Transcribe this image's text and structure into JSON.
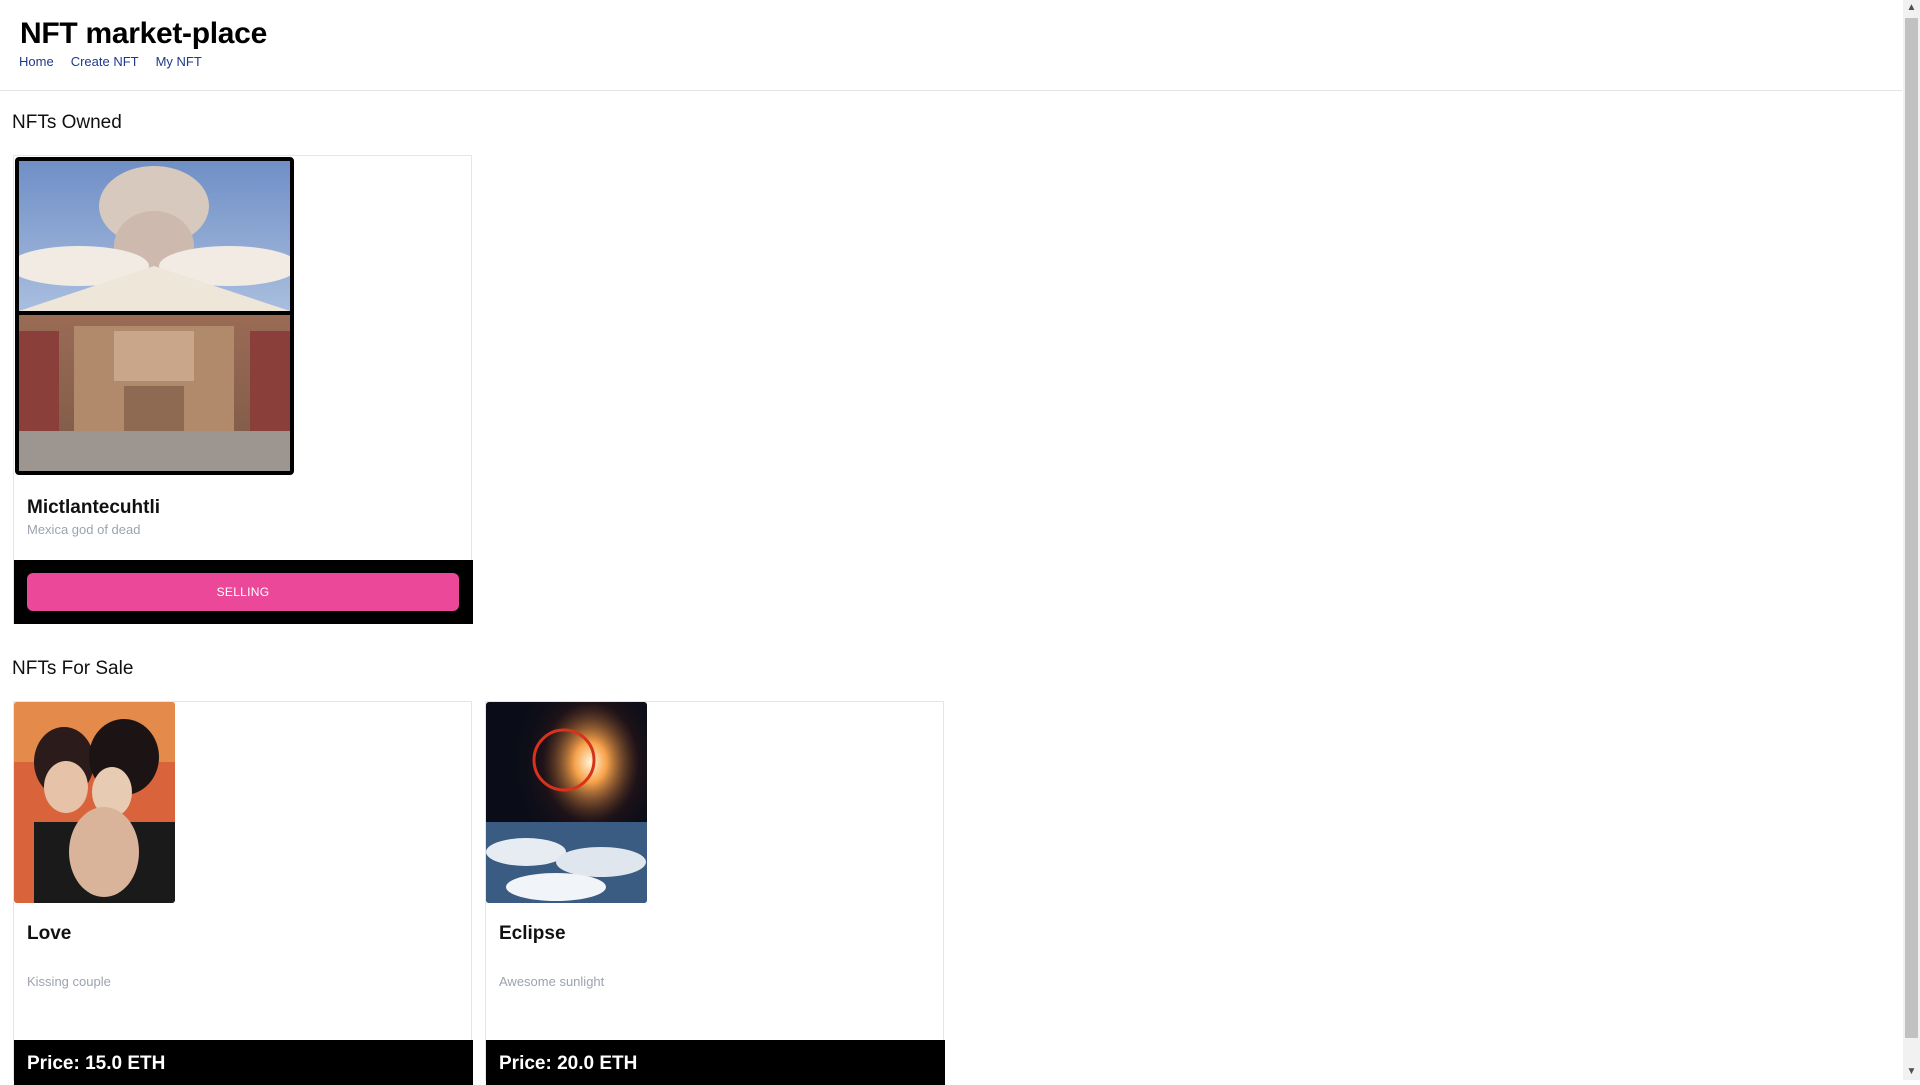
{
  "header": {
    "title": "NFT market-place",
    "nav": [
      "Home",
      "Create NFT",
      "My NFT"
    ]
  },
  "owned": {
    "heading": "NFTs Owned",
    "items": [
      {
        "name": "Mictlantecuhtli",
        "description": "Mexica god of dead",
        "action_label": "SELLING"
      }
    ]
  },
  "for_sale": {
    "heading": "NFTs For Sale",
    "items": [
      {
        "name": "Love",
        "description": "Kissing couple",
        "price": "Price: 15.0 ETH"
      },
      {
        "name": "Eclipse",
        "description": "Awesome sunlight",
        "price": "Price: 20.0 ETH"
      }
    ]
  },
  "colors": {
    "accent": "#ec4899",
    "footer": "#000000",
    "nav_link": "#1f3a8a",
    "muted_text": "#9ca3af"
  },
  "icons": {
    "scroll_up": "chevron-up-icon",
    "scroll_down": "chevron-down-icon"
  }
}
